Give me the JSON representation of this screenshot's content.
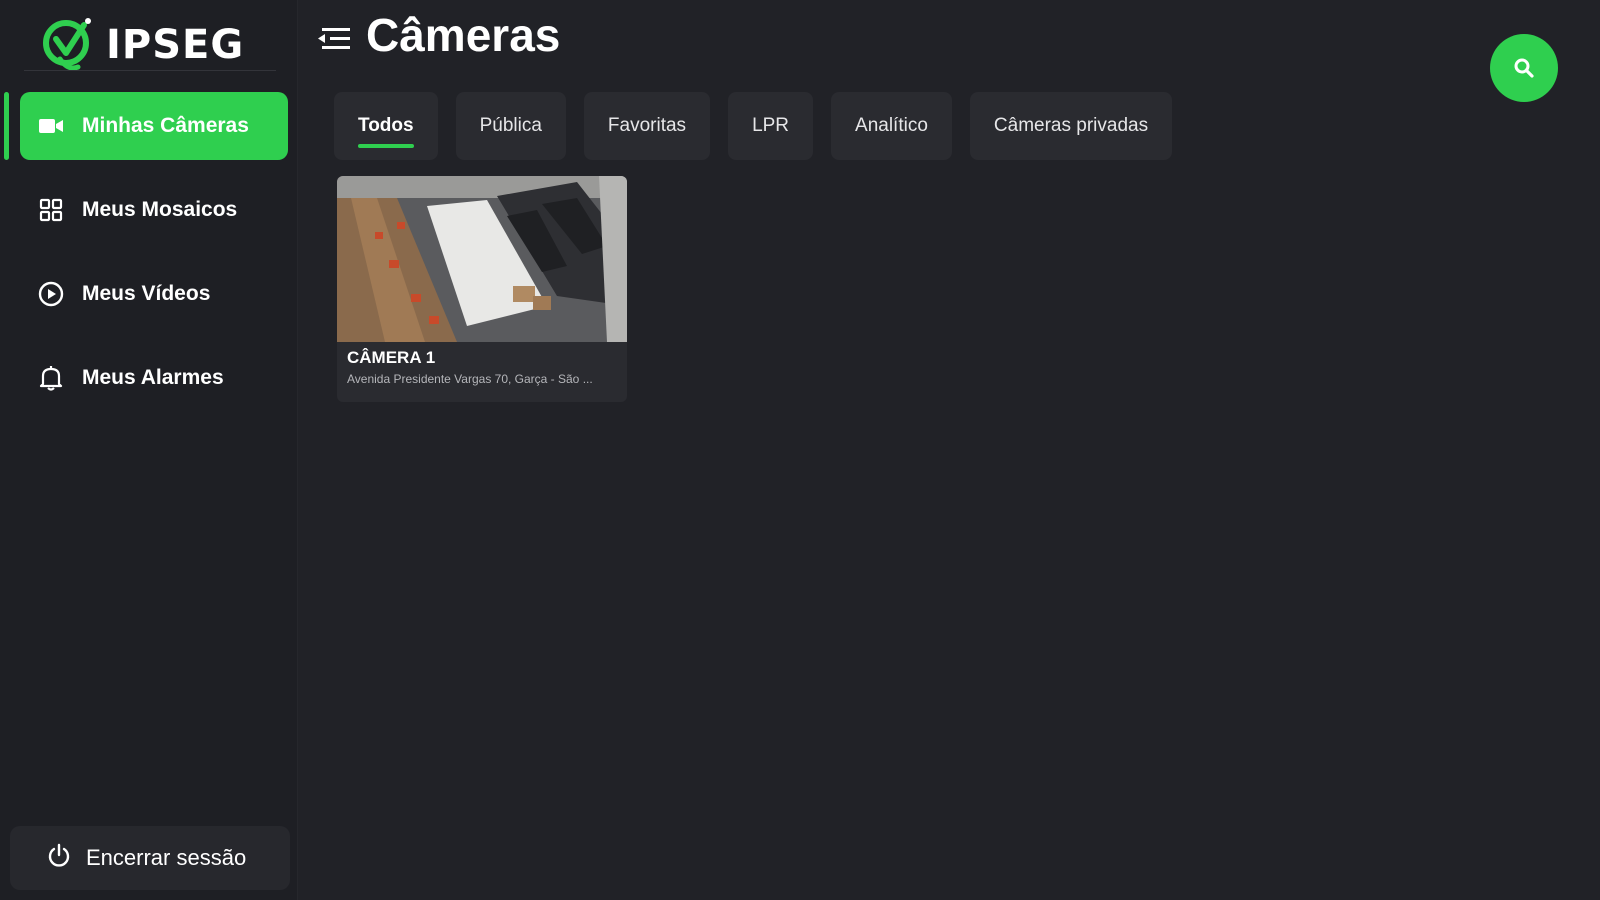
{
  "app": {
    "brand": "IPSEG",
    "accent_color": "#2fcf4f",
    "background_color": "#212227"
  },
  "sidebar": {
    "items": [
      {
        "label": "Minhas Câmeras",
        "icon": "video-camera-icon",
        "active": true
      },
      {
        "label": "Meus Mosaicos",
        "icon": "grid-icon",
        "active": false
      },
      {
        "label": "Meus Vídeos",
        "icon": "play-circle-icon",
        "active": false
      },
      {
        "label": "Meus Alarmes",
        "icon": "bell-icon",
        "active": false
      }
    ],
    "logout_label": "Encerrar sessão",
    "logout_icon": "power-icon"
  },
  "header": {
    "title": "Câmeras",
    "menu_icon": "menu-collapse-icon",
    "search_icon": "search-icon"
  },
  "tabs": [
    {
      "label": "Todos",
      "active": true
    },
    {
      "label": "Pública",
      "active": false
    },
    {
      "label": "Favoritas",
      "active": false
    },
    {
      "label": "LPR",
      "active": false
    },
    {
      "label": "Analítico",
      "active": false
    },
    {
      "label": "Câmeras privadas",
      "active": false
    }
  ],
  "cameras": [
    {
      "title": "CÂMERA 1",
      "address": "Avenida Presidente Vargas 70, Garça - São ..."
    }
  ]
}
